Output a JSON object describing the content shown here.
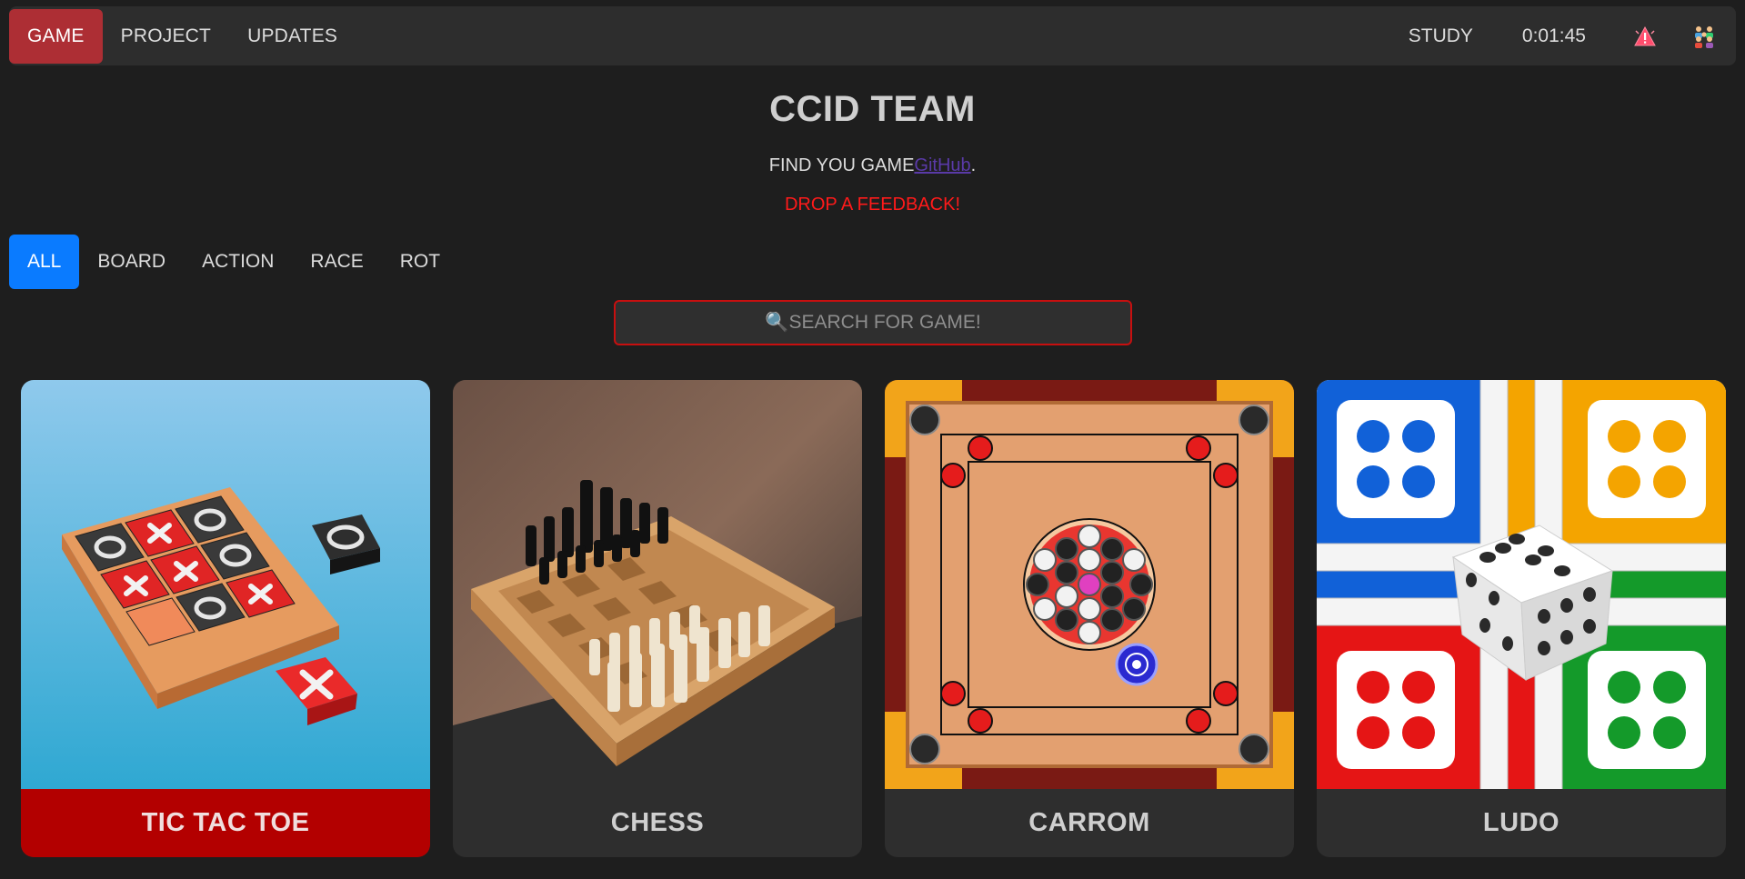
{
  "nav": {
    "items": [
      {
        "label": "GAME",
        "active": true
      },
      {
        "label": "PROJECT",
        "active": false
      },
      {
        "label": "UPDATES",
        "active": false
      }
    ],
    "study_label": "STUDY",
    "timer": "0:01:45",
    "alert_icon": "alert-icon",
    "team_icon": "team-icon"
  },
  "header": {
    "title": "CCID TEAM",
    "subtitle_text": "FIND YOU GAME",
    "subtitle_link": "GitHub",
    "subtitle_end": ".",
    "feedback": "DROP A FEEDBACK!"
  },
  "categories": [
    {
      "label": "ALL",
      "active": true
    },
    {
      "label": "BOARD",
      "active": false
    },
    {
      "label": "ACTION",
      "active": false
    },
    {
      "label": "RACE",
      "active": false
    },
    {
      "label": "ROT",
      "active": false
    }
  ],
  "search": {
    "placeholder": "🔍SEARCH FOR GAME!"
  },
  "games": [
    {
      "title": "TIC TAC TOE",
      "highlighted": true
    },
    {
      "title": "CHESS",
      "highlighted": false
    },
    {
      "title": "CARROM",
      "highlighted": false
    },
    {
      "title": "LUDO",
      "highlighted": false
    }
  ],
  "colors": {
    "background": "#1e1e1e",
    "nav_active": "#ad2e34",
    "category_active": "#0a7bff",
    "feedback": "#ff1a1a",
    "card_highlight": "#b30000"
  }
}
